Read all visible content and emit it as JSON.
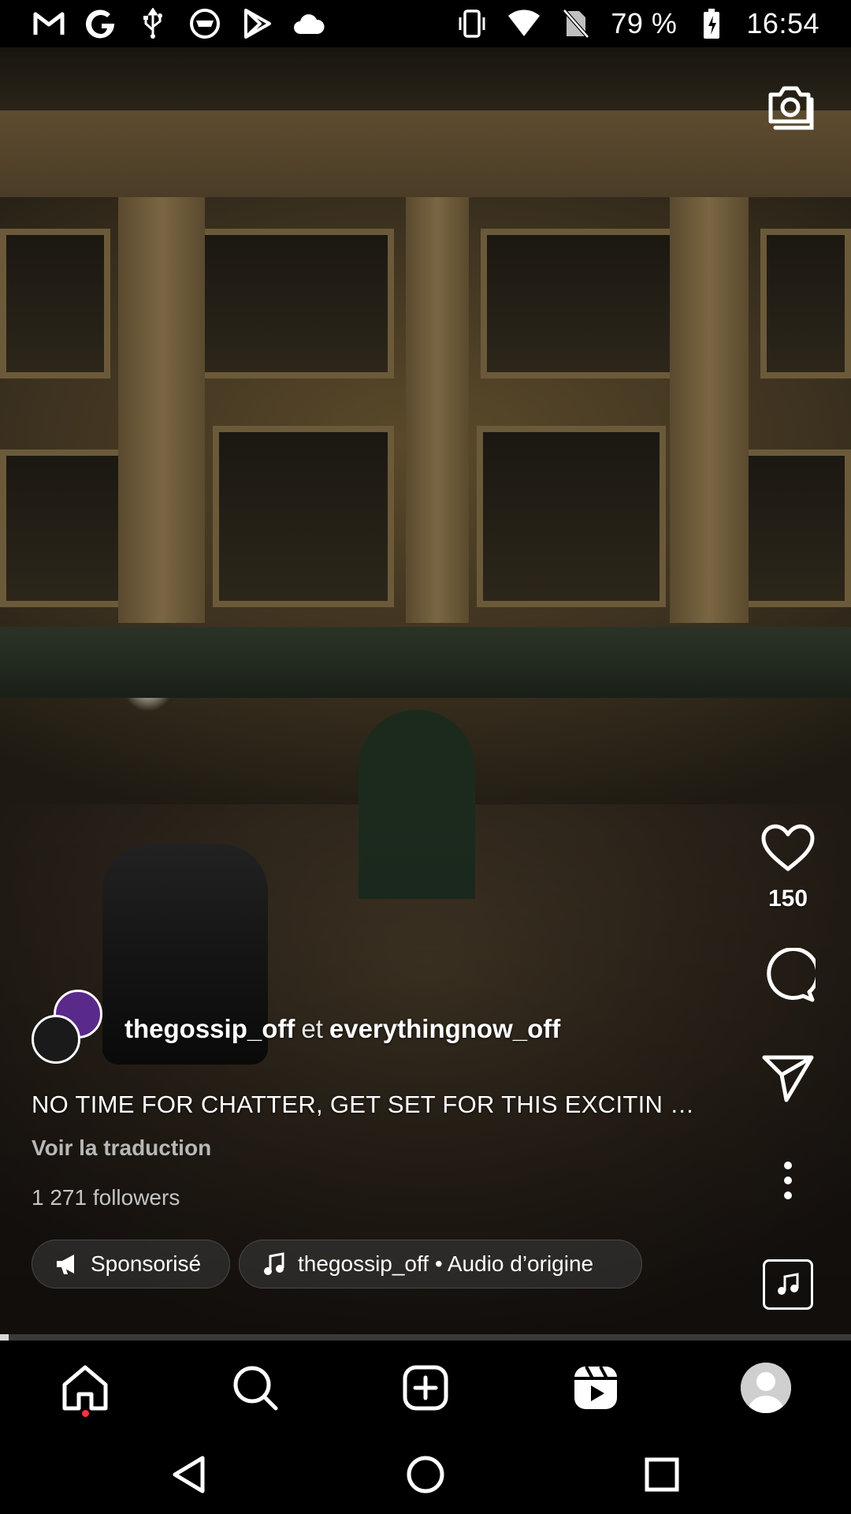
{
  "status_bar": {
    "left_icons": [
      "gmail-icon",
      "google-icon",
      "usb-icon",
      "vpn-icon",
      "play-store-icon",
      "cloud-icon"
    ],
    "right_icons": [
      "vibrate-icon",
      "wifi-icon",
      "no-sim-icon"
    ],
    "battery_text": "79 %",
    "time": "16:54"
  },
  "reel": {
    "author_primary": "thegossip_off",
    "author_connector": "et",
    "author_secondary": "everythingnow_off",
    "caption": "NO TIME FOR CHATTER, GET SET FOR THIS EXCITIN …",
    "translate_label": "Voir la traduction",
    "followers": "1 271 followers",
    "sponsored_label": "Sponsorisé",
    "audio_label": "thegossip_off • Audio d’origine",
    "like_count": "150",
    "progress_fraction": 0.01
  },
  "bottom_nav": [
    "home-icon",
    "search-icon",
    "create-icon",
    "reels-icon",
    "profile-icon"
  ],
  "system_nav": [
    "back-icon",
    "home-circle-icon",
    "recents-icon"
  ]
}
